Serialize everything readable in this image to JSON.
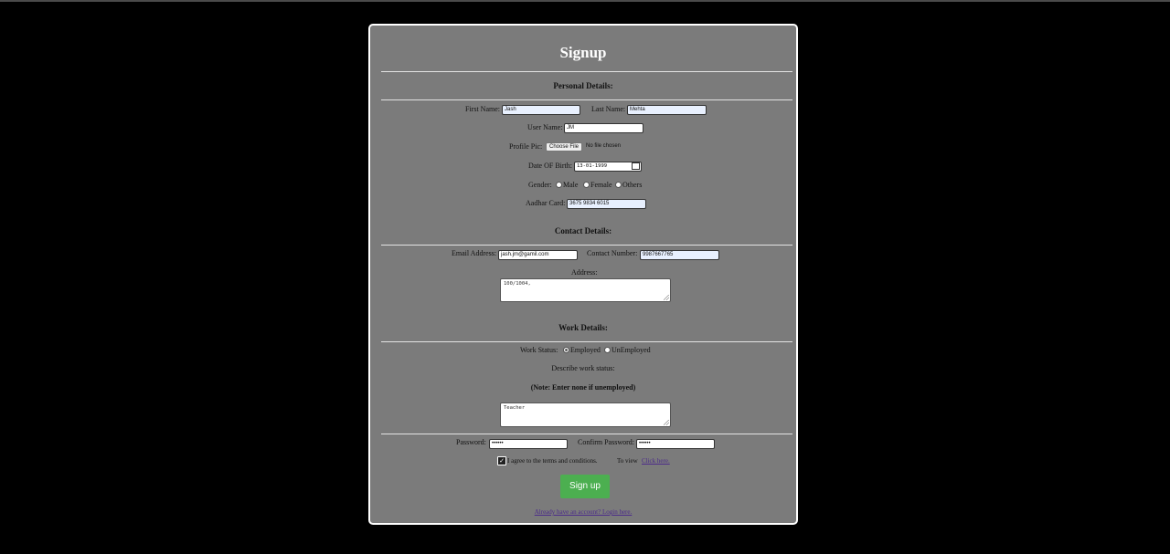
{
  "form": {
    "title": "Signup",
    "personal": {
      "heading": "Personal Details:",
      "first_name_label": "First Name:",
      "first_name_value": "Jash",
      "last_name_label": "Last Name:",
      "last_name_value": "Mehta",
      "user_name_label": "User Name:",
      "user_name_value": "JM",
      "profile_pic_label": "Profile Pic:",
      "choose_file": "Choose File",
      "no_file": "No file chosen",
      "dob_label": "Date OF Birth:",
      "dob_value": "13-01-1999",
      "gender_label": "Gender:",
      "gender_options": [
        "Male",
        "Female",
        "Others"
      ],
      "aadhar_label": "Aadhar Card:",
      "aadhar_value": "3675 9834 6015"
    },
    "contact": {
      "heading": "Contact Details:",
      "email_label": "Email Address:",
      "email_value": "jash.jm@gamil.com",
      "phone_label": "Contact Number:",
      "phone_value": "9987667765",
      "address_label": "Address:",
      "address_value": "100/1004,"
    },
    "work": {
      "heading": "Work Details:",
      "status_label": "Work Status:",
      "status_options": [
        "Employed",
        "UnEmployed"
      ],
      "describe_label": "Describe work status:",
      "note": "(Note: Enter none if unemployed)",
      "describe_value": "Teacher"
    },
    "password_label": "Password:",
    "password_value": "••••••",
    "confirm_label": "Confirm Password:",
    "confirm_value": "••••••",
    "terms_text": "I agree to the terms and conditions.",
    "to_view": "To view",
    "click_here": "Click here.",
    "submit_label": "Sign up",
    "login_link": "Already have an account? Login here."
  },
  "colors": {
    "background": "#000000",
    "card": "#7b7b7b",
    "submit": "#4caf50",
    "link": "#4b2a8a"
  }
}
